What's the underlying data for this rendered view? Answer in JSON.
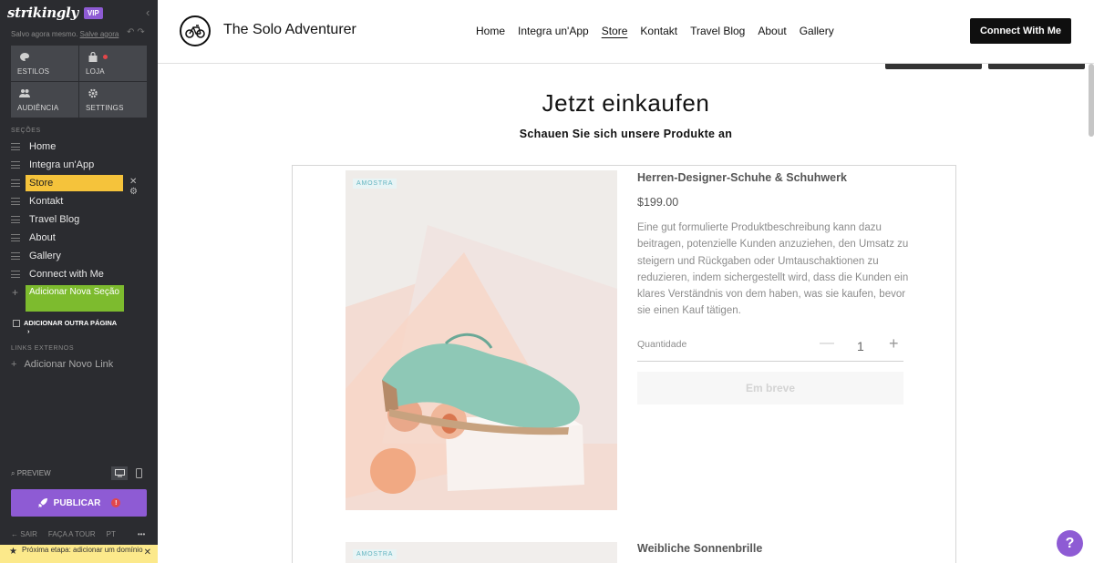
{
  "editor": {
    "logo": "strikingly",
    "vip": "VIP",
    "saved_text": "Salvo agora mesmo.",
    "saved_link": "Salve agora",
    "tiles": [
      {
        "label": "ESTILOS",
        "icon": "palette-icon"
      },
      {
        "label": "LOJA",
        "icon": "bag-icon"
      },
      {
        "label": "AUDIÊNCIA",
        "icon": "people-icon"
      },
      {
        "label": "SETTINGS",
        "icon": "gear-icon"
      }
    ],
    "sections_heading": "SEÇÕES",
    "sections": [
      "Home",
      "Integra un'App",
      "Store",
      "Kontakt",
      "Travel Blog",
      "About",
      "Gallery",
      "Connect with Me"
    ],
    "active_section": "Store",
    "add_section": "Adicionar Nova Seção",
    "add_page": "ADICIONAR OUTRA PÁGINA",
    "external_heading": "LINKS EXTERNOS",
    "add_link": "Adicionar Novo Link",
    "preview": "PREVIEW",
    "publish": "PUBLICAR",
    "footer": {
      "exit": "SAIR",
      "tour": "FAÇA A TOUR",
      "lang": "PT",
      "more": "•••"
    },
    "next_step": "Próxima etapa: adicionar um domínio"
  },
  "site": {
    "brand": "The Solo Adventurer",
    "nav": [
      "Home",
      "Integra un'App",
      "Store",
      "Kontakt",
      "Travel Blog",
      "About",
      "Gallery"
    ],
    "current_nav": "Store",
    "cta": "Connect With Me",
    "title": "Jetzt einkaufen",
    "subtitle": "Schauen Sie sich unsere Produkte an",
    "products": [
      {
        "badge": "AMOSTRA",
        "name": "Herren-Designer-Schuhe & Schuhwerk",
        "price": "$199.00",
        "description": "Eine gut formulierte Produktbeschreibung kann dazu beitragen, potenzielle Kunden anzuziehen, den Umsatz zu steigern und Rückgaben oder Umtauschaktionen zu reduzieren, indem sichergestellt wird, dass die Kunden ein klares Verständnis von dem haben, was sie kaufen, bevor sie einen Kauf tätigen.",
        "qty_label": "Quantidade",
        "qty": "1",
        "button": "Em breve"
      },
      {
        "badge": "AMOSTRA",
        "name": "Weibliche Sonnenbrille"
      }
    ],
    "help": "?"
  },
  "colors": {
    "accent": "#8e5bd4",
    "active_section": "#f5c33b",
    "add_section": "#7dbb2e",
    "sidebar": "#2b2c30"
  }
}
